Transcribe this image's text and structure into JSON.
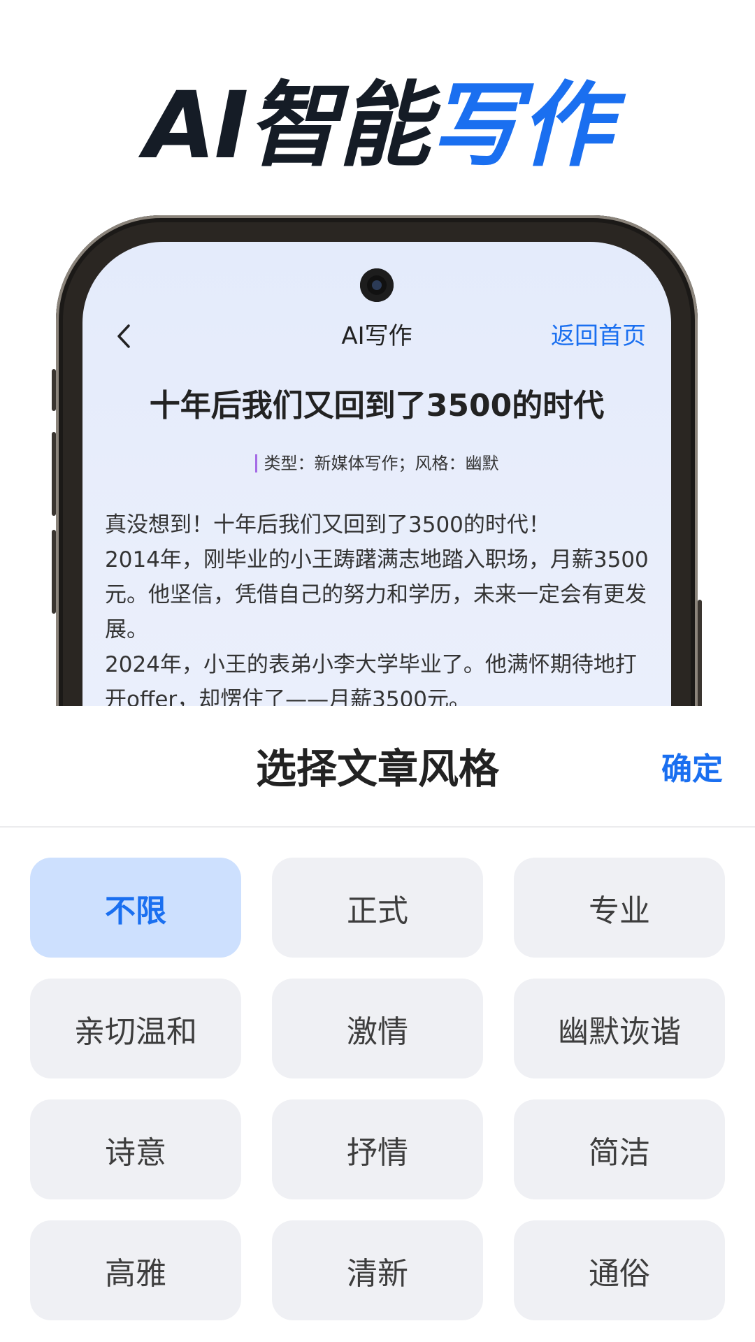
{
  "hero": {
    "title_dark": "AI智能",
    "title_blue": "写作"
  },
  "phone_screen": {
    "nav": {
      "back_icon": "chevron-left-icon",
      "title": "AI写作",
      "home_link": "返回首页"
    },
    "article": {
      "title": "十年后我们又回到了3500的时代",
      "meta": "类型：新媒体写作；风格：幽默",
      "paragraphs": [
        "真没想到！十年后我们又回到了3500的时代！",
        "2014年，刚毕业的小王踌躇满志地踏入职场，月薪3500元。他坚信，凭借自己的努力和学历，未来一定会有更发展。",
        "2024年，小王的表弟小李大学毕业了。他满怀期待地打开offer，却愣住了——月薪3500元。"
      ]
    }
  },
  "sheet": {
    "title": "选择文章风格",
    "confirm": "确定",
    "selected": "不限",
    "options": [
      "不限",
      "正式",
      "专业",
      "亲切温和",
      "激情",
      "幽默诙谐",
      "诗意",
      "抒情",
      "简洁",
      "高雅",
      "清新",
      "通俗"
    ]
  },
  "colors": {
    "accent": "#1a6ff0",
    "chip_bg": "#eff0f4",
    "chip_selected_bg": "#cde0fe"
  }
}
